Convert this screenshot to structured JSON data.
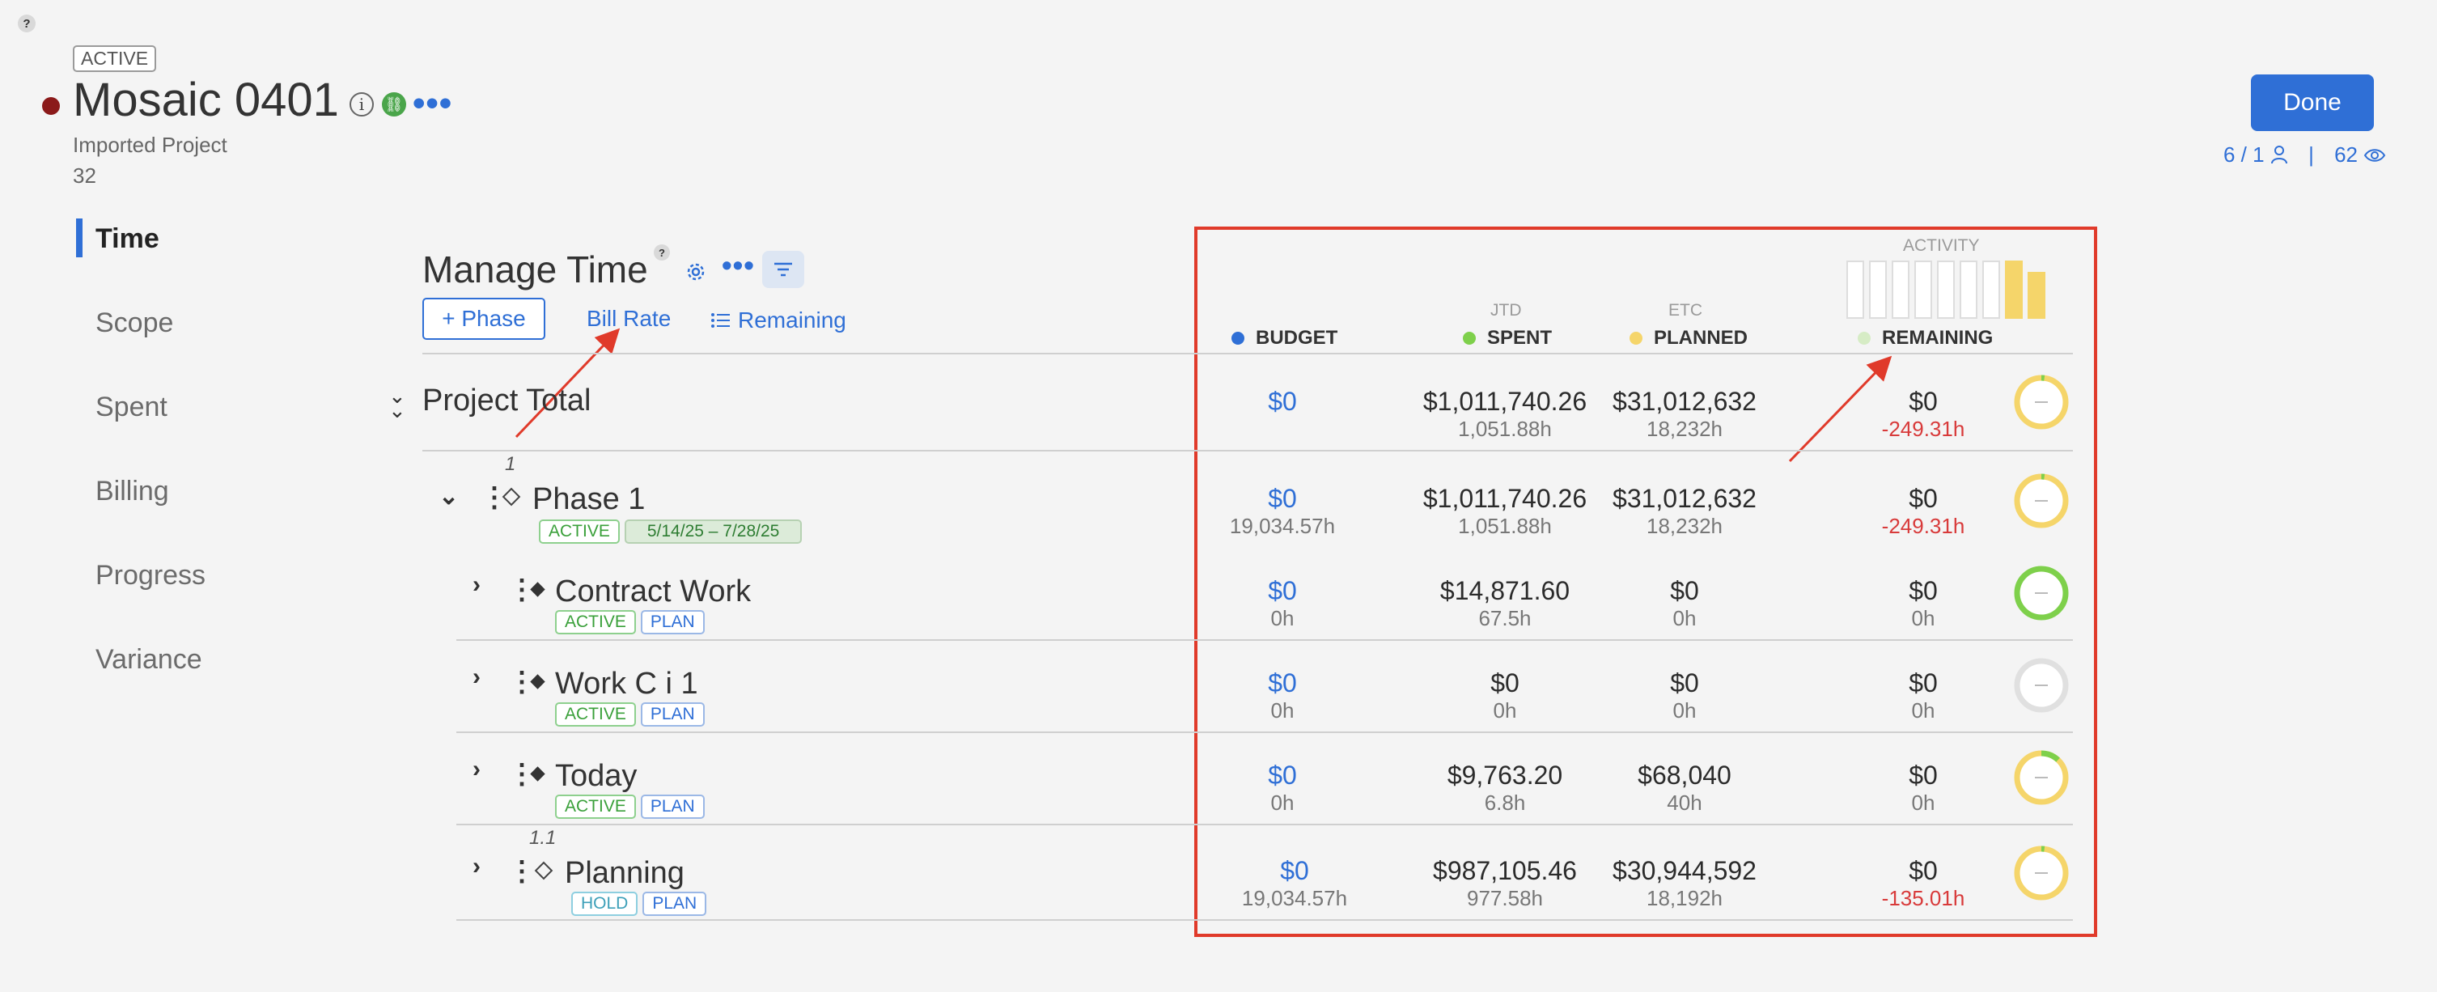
{
  "header": {
    "help": "?",
    "status": "ACTIVE",
    "title": "Mosaic 0401",
    "info": "i",
    "link": "⛓",
    "more": "•••",
    "subtitle": "Imported Project",
    "number": "32",
    "done_label": "Done",
    "members": "6 / 1",
    "separator": "|",
    "views": "62"
  },
  "sidebar": {
    "items": [
      {
        "label": "Time"
      },
      {
        "label": "Scope"
      },
      {
        "label": "Spent"
      },
      {
        "label": "Billing"
      },
      {
        "label": "Progress"
      },
      {
        "label": "Variance"
      }
    ]
  },
  "manage": {
    "title": "Manage Time",
    "help": "?",
    "more": "•••",
    "add_phase": "+ Phase",
    "bill_rate": "Bill Rate",
    "remaining": "Remaining"
  },
  "columns": {
    "budget": "BUDGET",
    "spent_sub": "JTD",
    "spent": "SPENT",
    "planned_sub": "ETC",
    "planned": "PLANNED",
    "remaining": "REMAINING",
    "activity": "ACTIVITY",
    "activity_levels": [
      0,
      0,
      0,
      0,
      0,
      0,
      0,
      1.0,
      0.8
    ]
  },
  "colors": {
    "accent": "#2f6fd6",
    "budget_dot": "#2f6fd6",
    "spent_dot": "#7ed04b",
    "planned_dot": "#f5d56a",
    "remaining_dot": "#d6ecc5",
    "negative": "#d83a3a"
  },
  "total": {
    "label": "Project Total",
    "budget": "$0",
    "spent": "$1,011,740.26",
    "spent_h": "1,051.88h",
    "planned": "$31,012,632",
    "planned_h": "18,232h",
    "remaining": "$0",
    "remaining_h": "-249.31h",
    "progress": 0.02
  },
  "rows": [
    {
      "number": "1",
      "name": "Phase 1",
      "status": "ACTIVE",
      "date_range": "5/14/25  –  7/28/25",
      "budget": "$0",
      "budget_h": "19,034.57h",
      "spent": "$1,011,740.26",
      "spent_h": "1,051.88h",
      "planned": "$31,012,632",
      "planned_h": "18,232h",
      "remaining": "$0",
      "remaining_h": "-249.31h",
      "progress": 0.02
    },
    {
      "name": "Contract Work",
      "status": "ACTIVE",
      "plan": "PLAN",
      "budget": "$0",
      "budget_h": "0h",
      "spent": "$14,871.60",
      "spent_h": "67.5h",
      "planned": "$0",
      "planned_h": "0h",
      "remaining": "$0",
      "remaining_h": "0h",
      "progress": 1.0
    },
    {
      "name": "Work C i 1",
      "status": "ACTIVE",
      "plan": "PLAN",
      "budget": "$0",
      "budget_h": "0h",
      "spent": "$0",
      "spent_h": "0h",
      "planned": "$0",
      "planned_h": "0h",
      "remaining": "$0",
      "remaining_h": "0h",
      "progress": 0
    },
    {
      "name": "Today",
      "status": "ACTIVE",
      "plan": "PLAN",
      "budget": "$0",
      "budget_h": "0h",
      "spent": "$9,763.20",
      "spent_h": "6.8h",
      "planned": "$68,040",
      "planned_h": "40h",
      "remaining": "$0",
      "remaining_h": "0h",
      "progress": 0.12
    },
    {
      "number": "1.1",
      "name": "Planning",
      "status": "HOLD",
      "plan": "PLAN",
      "budget": "$0",
      "budget_h": "19,034.57h",
      "spent": "$987,105.46",
      "spent_h": "977.58h",
      "planned": "$30,944,592",
      "planned_h": "18,192h",
      "remaining": "$0",
      "remaining_h": "-135.01h",
      "progress": 0.02
    }
  ]
}
